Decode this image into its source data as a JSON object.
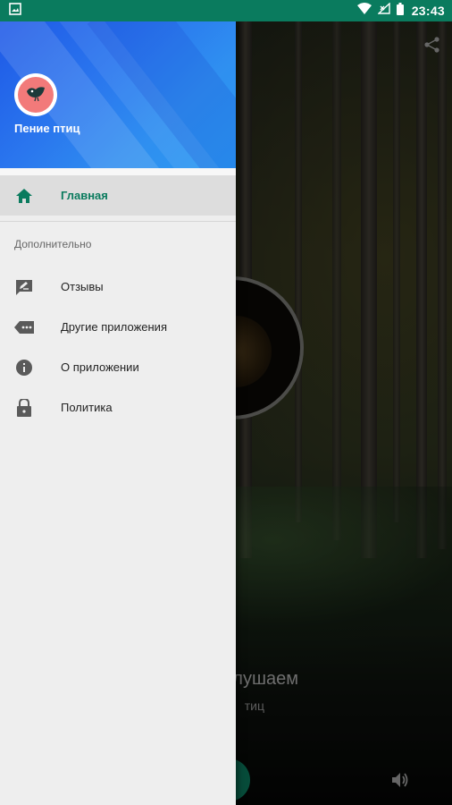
{
  "status_bar": {
    "time": "23:43"
  },
  "player": {
    "title_visible": "слушаем",
    "subtitle_visible": "тиц"
  },
  "drawer": {
    "app_name": "Пение птиц",
    "primary_item": {
      "label": "Главная",
      "icon": "home-icon"
    },
    "section_title": "Дополнительно",
    "items": [
      {
        "label": "Отзывы",
        "icon": "feedback-icon"
      },
      {
        "label": "Другие приложения",
        "icon": "more-apps-icon"
      },
      {
        "label": "О приложении",
        "icon": "info-icon"
      },
      {
        "label": "Политика",
        "icon": "lock-icon"
      }
    ]
  },
  "colors": {
    "accent": "#0a7b5e",
    "header_gradient_start": "#1e58e6",
    "header_gradient_end": "#2a9af2",
    "avatar_bg": "#f27a7a"
  }
}
